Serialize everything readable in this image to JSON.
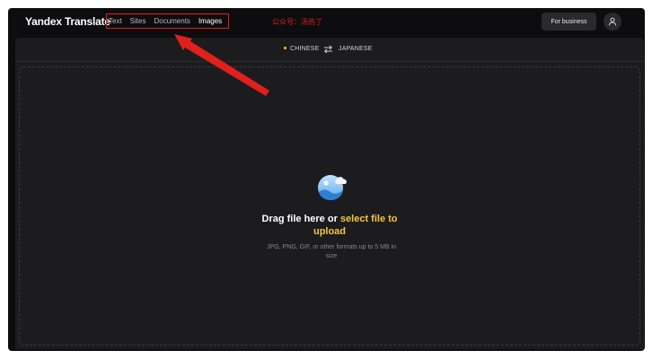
{
  "app": {
    "logo": "Yandex Translate"
  },
  "nav": {
    "items": [
      {
        "label": "Text"
      },
      {
        "label": "Sites"
      },
      {
        "label": "Documents"
      },
      {
        "label": "Images"
      }
    ],
    "active": "Images"
  },
  "watermark": "公众号：汤热了",
  "header": {
    "business_label": "For business",
    "user_icon": "user-icon"
  },
  "languages": {
    "source": "CHINESE",
    "target": "JAPANESE",
    "swap_icon": "swap-arrows-icon"
  },
  "upload": {
    "icon": "image-upload-icon",
    "drag_prefix": "Drag file here or ",
    "select_link": "select file to",
    "select_link_2": "upload",
    "hint_line1": "JPG, PNG, GIF, or other formats up to 5 MB in",
    "hint_line2": "size"
  },
  "colors": {
    "accent": "#f2c73a",
    "annotation": "#e0201b",
    "background": "#0d0d0f",
    "panel": "#1c1c1f"
  }
}
